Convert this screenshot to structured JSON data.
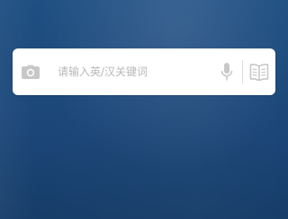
{
  "colors": {
    "background": "#1e4b7d",
    "search_bar": "#ffffff",
    "icon": "#c8c8c8"
  },
  "search": {
    "placeholder": "请输入英/汉关键词",
    "value": ""
  },
  "icons": {
    "camera": "camera-icon",
    "microphone": "microphone-icon",
    "dictionary": "book-icon"
  }
}
